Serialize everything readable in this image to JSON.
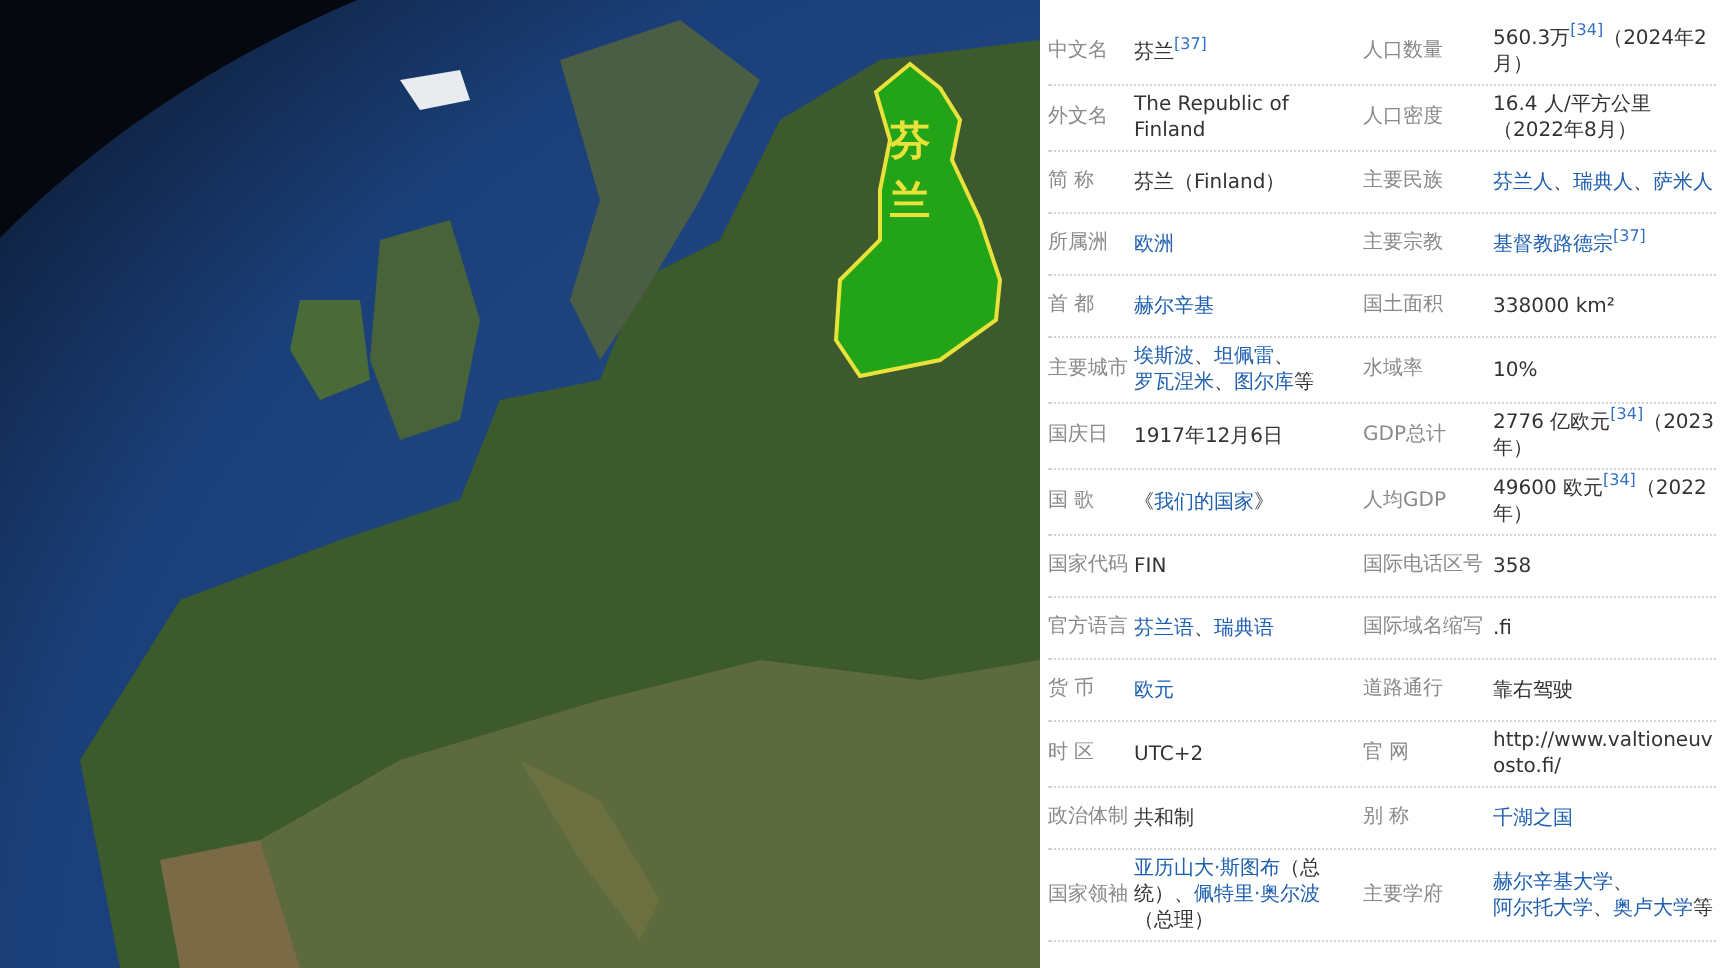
{
  "map": {
    "label": "芬兰"
  },
  "table": {
    "rows": [
      {
        "left": {
          "label": "中文名",
          "value": [
            {
              "kind": "text",
              "text": "芬兰"
            },
            {
              "kind": "ref",
              "text": "[37]"
            }
          ]
        },
        "right": {
          "label": "人口数量",
          "value": [
            {
              "kind": "text",
              "text": "560.3万"
            },
            {
              "kind": "ref",
              "text": "[34]"
            },
            {
              "kind": "text",
              "text": "（2024年2月）"
            }
          ]
        }
      },
      {
        "left": {
          "label": "外文名",
          "value": [
            {
              "kind": "text",
              "text": "The Republic of Finland"
            }
          ]
        },
        "right": {
          "label": "人口密度",
          "value": [
            {
              "kind": "text",
              "text": "16.4 人/平方公里（2022年8月）"
            }
          ]
        }
      },
      {
        "left": {
          "label": "简 称",
          "value": [
            {
              "kind": "text",
              "text": "芬兰（Finland）"
            }
          ]
        },
        "right": {
          "label": "主要民族",
          "value": [
            {
              "kind": "link",
              "text": "芬兰人"
            },
            {
              "kind": "text",
              "text": "、"
            },
            {
              "kind": "link",
              "text": "瑞典人"
            },
            {
              "kind": "text",
              "text": "、"
            },
            {
              "kind": "link",
              "text": "萨米人"
            }
          ]
        }
      },
      {
        "left": {
          "label": "所属洲",
          "value": [
            {
              "kind": "link",
              "text": "欧洲"
            }
          ]
        },
        "right": {
          "label": "主要宗教",
          "value": [
            {
              "kind": "link",
              "text": "基督教路德宗"
            },
            {
              "kind": "ref",
              "text": "[37]"
            }
          ]
        }
      },
      {
        "left": {
          "label": "首 都",
          "value": [
            {
              "kind": "link",
              "text": "赫尔辛基"
            }
          ]
        },
        "right": {
          "label": "国土面积",
          "value": [
            {
              "kind": "text",
              "text": "338000 km²"
            }
          ]
        }
      },
      {
        "left": {
          "label": "主要城市",
          "value": [
            {
              "kind": "link",
              "text": "埃斯波"
            },
            {
              "kind": "text",
              "text": "、"
            },
            {
              "kind": "link",
              "text": "坦佩雷"
            },
            {
              "kind": "text",
              "text": "、"
            },
            {
              "kind": "link",
              "text": "罗瓦涅米"
            },
            {
              "kind": "text",
              "text": "、"
            },
            {
              "kind": "link",
              "text": "图尔库"
            },
            {
              "kind": "text",
              "text": "等"
            }
          ]
        },
        "right": {
          "label": "水域率",
          "value": [
            {
              "kind": "text",
              "text": "10%"
            }
          ]
        }
      },
      {
        "left": {
          "label": "国庆日",
          "value": [
            {
              "kind": "text",
              "text": "1917年12月6日"
            }
          ]
        },
        "right": {
          "label": "GDP总计",
          "value": [
            {
              "kind": "text",
              "text": "2776 亿欧元"
            },
            {
              "kind": "ref",
              "text": "[34]"
            },
            {
              "kind": "text",
              "text": "（2023年）"
            }
          ]
        }
      },
      {
        "left": {
          "label": "国 歌",
          "value": [
            {
              "kind": "text",
              "text": "《"
            },
            {
              "kind": "link",
              "text": "我们的国家"
            },
            {
              "kind": "text",
              "text": "》"
            }
          ]
        },
        "right": {
          "label": "人均GDP",
          "value": [
            {
              "kind": "text",
              "text": "49600 欧元"
            },
            {
              "kind": "ref",
              "text": "[34]"
            },
            {
              "kind": "text",
              "text": "（2022年）"
            }
          ]
        }
      },
      {
        "left": {
          "label": "国家代码",
          "value": [
            {
              "kind": "text",
              "text": "FIN"
            }
          ]
        },
        "right": {
          "label": "国际电话区号",
          "value": [
            {
              "kind": "text",
              "text": "358"
            }
          ]
        }
      },
      {
        "left": {
          "label": "官方语言",
          "value": [
            {
              "kind": "link",
              "text": "芬兰语"
            },
            {
              "kind": "text",
              "text": "、"
            },
            {
              "kind": "link",
              "text": "瑞典语"
            }
          ]
        },
        "right": {
          "label": "国际域名缩写",
          "value": [
            {
              "kind": "text",
              "text": ".fi"
            }
          ]
        }
      },
      {
        "left": {
          "label": "货 币",
          "value": [
            {
              "kind": "link",
              "text": "欧元"
            }
          ]
        },
        "right": {
          "label": "道路通行",
          "value": [
            {
              "kind": "text",
              "text": "靠右驾驶"
            }
          ]
        }
      },
      {
        "left": {
          "label": "时 区",
          "value": [
            {
              "kind": "text",
              "text": "UTC+2"
            }
          ]
        },
        "right": {
          "label": "官 网",
          "value": [
            {
              "kind": "text",
              "text": "http://www.valtioneuvosto.fi/"
            }
          ]
        }
      },
      {
        "left": {
          "label": "政治体制",
          "value": [
            {
              "kind": "text",
              "text": "共和制"
            }
          ]
        },
        "right": {
          "label": "别 称",
          "value": [
            {
              "kind": "link",
              "text": "千湖之国"
            }
          ]
        }
      },
      {
        "left": {
          "label": "国家领袖",
          "value": [
            {
              "kind": "link",
              "text": "亚历山大·斯图布"
            },
            {
              "kind": "text",
              "text": "（总统）、"
            },
            {
              "kind": "link",
              "text": "佩特里·奥尔波"
            },
            {
              "kind": "text",
              "text": "（总理）"
            }
          ]
        },
        "right": {
          "label": "主要学府",
          "value": [
            {
              "kind": "link",
              "text": "赫尔辛基大学"
            },
            {
              "kind": "text",
              "text": "、"
            },
            {
              "kind": "link",
              "text": "阿尔托大学"
            },
            {
              "kind": "text",
              "text": "、"
            },
            {
              "kind": "link",
              "text": "奥卢大学"
            },
            {
              "kind": "text",
              "text": "等"
            }
          ]
        }
      }
    ]
  }
}
